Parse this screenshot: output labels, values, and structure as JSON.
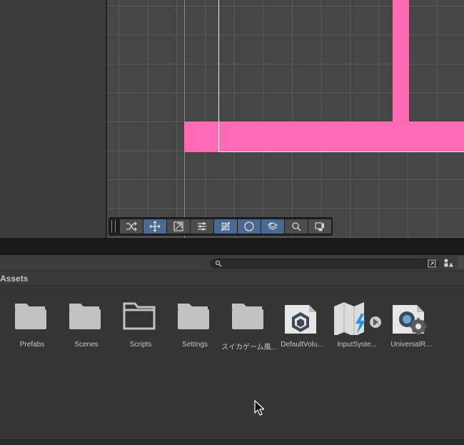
{
  "toolbar": {
    "buttons": [
      {
        "icon": "shuffle-icon",
        "active": false
      },
      {
        "icon": "move-arrows-icon",
        "active": true
      },
      {
        "icon": "snap-icon",
        "active": false
      },
      {
        "icon": "sliders-icon",
        "active": false
      },
      {
        "icon": "grid-hatch-icon",
        "active": true
      },
      {
        "icon": "moon-icon",
        "active": true
      },
      {
        "icon": "layers-icon",
        "active": true
      },
      {
        "icon": "magnifier-icon",
        "active": false
      },
      {
        "icon": "camera-eye-icon",
        "active": false
      }
    ]
  },
  "project": {
    "search": {
      "value": "",
      "placeholder": ""
    },
    "breadcrumb": "Assets",
    "items": [
      {
        "label": "Prefabs",
        "icon": "folder-icon"
      },
      {
        "label": "Scenes",
        "icon": "folder-icon"
      },
      {
        "label": "Scripts",
        "icon": "empty-folder-icon"
      },
      {
        "label": "Settings",
        "icon": "folder-icon"
      },
      {
        "label": "スイカゲーム風...",
        "icon": "folder-icon"
      },
      {
        "label": "DefaultVolu...",
        "icon": "volume-profile-icon"
      },
      {
        "label": "InputSyste...",
        "icon": "input-actions-icon"
      },
      {
        "label": "UniversalR...",
        "icon": "render-pipeline-asset-icon"
      }
    ]
  },
  "colors": {
    "accent_pink": "#ff6ab4",
    "active_tool": "#4a6a92",
    "folder": "#c2c2c2"
  }
}
